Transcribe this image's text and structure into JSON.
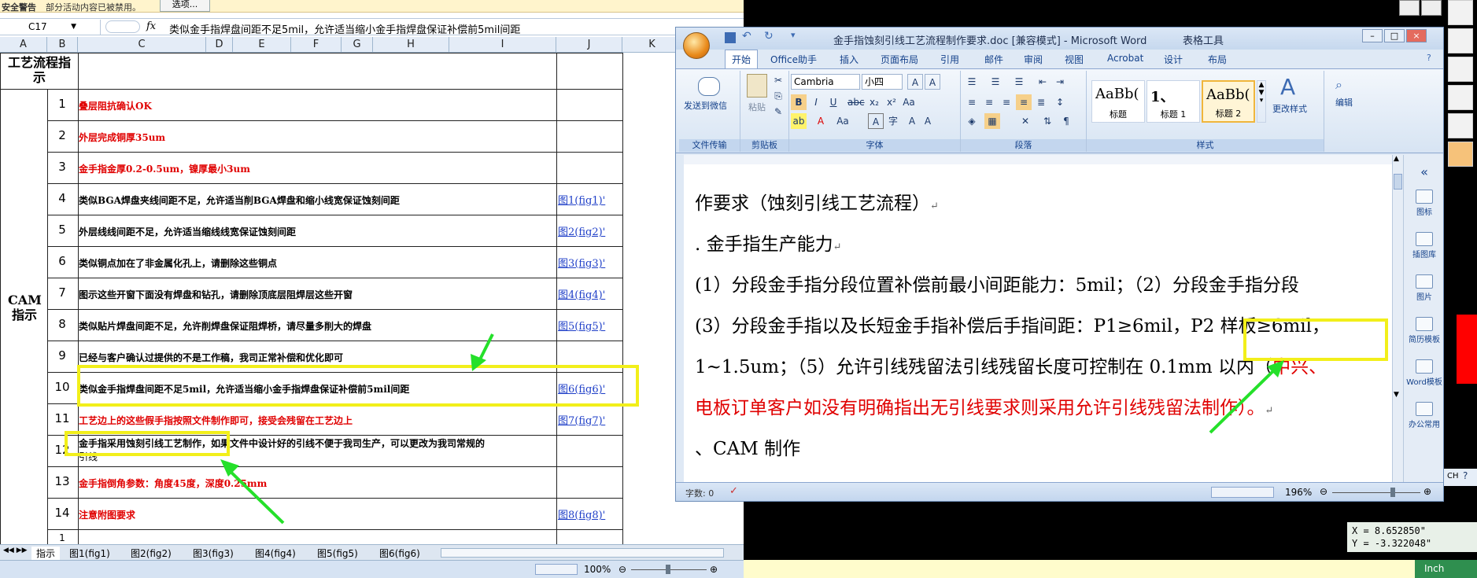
{
  "excel": {
    "security_warning": "安全警告",
    "security_msg": "部分活动内容已被禁用。",
    "options_btn": "选项...",
    "name_box": "C17",
    "fx": "fx",
    "formula": "类似金手指焊盘间距不足5mil，允许适当缩小金手指焊盘保证补偿前5mil间距",
    "columns": [
      "A",
      "B",
      "C",
      "D",
      "E",
      "F",
      "G",
      "H",
      "I",
      "J",
      "K"
    ],
    "header_cell": "工艺流程指示",
    "section": "CAM指示",
    "rows": [
      {
        "num": "1",
        "text": "叠层阻抗确认OK",
        "red": true,
        "link": ""
      },
      {
        "num": "2",
        "text": "外层完成铜厚35um",
        "red": true,
        "link": ""
      },
      {
        "num": "3",
        "text": "金手指金厚0.2-0.5um，镍厚最小3um",
        "red": true,
        "link": ""
      },
      {
        "num": "4",
        "text": "类似BGA焊盘夹线间距不足，允许适当削BGA焊盘和缩小线宽保证蚀刻间距",
        "red": false,
        "link": "图1(fig1)'"
      },
      {
        "num": "5",
        "text": "外层线线间距不足，允许适当缩线线宽保证蚀刻间距",
        "red": false,
        "link": "图2(fig2)'"
      },
      {
        "num": "6",
        "text": "类似铜点加在了非金属化孔上，请删除这些铜点",
        "red": false,
        "link": "图3(fig3)'"
      },
      {
        "num": "7",
        "text": "图示这些开窗下面没有焊盘和钻孔，请删除顶底层阻焊层这些开窗",
        "red": false,
        "link": "图4(fig4)'"
      },
      {
        "num": "8",
        "text": "类似贴片焊盘间距不足，允许削焊盘保证阻焊桥，请尽量多削大的焊盘",
        "red": false,
        "link": "图5(fig5)'"
      },
      {
        "num": "9",
        "text": "已经与客户确认过提供的不是工作稿，我司正常补偿和优化即可",
        "red": false,
        "link": ""
      },
      {
        "num": "10",
        "text": "类似金手指焊盘间距不足5mil，允许适当缩小金手指焊盘保证补偿前5mil间距",
        "red": false,
        "link": "图6(fig6)'"
      },
      {
        "num": "11",
        "text": "工艺边上的这些假手指按照文件制作即可，接受会残留在工艺边上",
        "red": true,
        "link": "图7(fig7)'"
      },
      {
        "num": "12",
        "text": "金手指采用蚀刻引线工艺制作，如果文件中设计好的引线不便于我司生产，可以更改为我司常规的",
        "text2": "引线",
        "red": false,
        "link": ""
      },
      {
        "num": "13",
        "text": "金手指倒角参数：角度45度，深度0.25mm",
        "red": true,
        "link": ""
      },
      {
        "num": "14",
        "text": "注意附图要求",
        "red": true,
        "link": "图8(fig8)'"
      }
    ],
    "row15_num": "1",
    "sheet_tabs": [
      "指示",
      "图1(fig1)",
      "图2(fig2)",
      "图3(fig3)",
      "图4(fig4)",
      "图5(fig5)",
      "图6(fig6)"
    ],
    "zoom": "100%"
  },
  "word": {
    "title": "金手指蚀刻引线工艺流程制作要求.doc [兼容模式] - Microsoft Word",
    "context_tab": "表格工具",
    "tabs": [
      "开始",
      "Office助手",
      "插入",
      "页面布局",
      "引用",
      "邮件",
      "审阅",
      "视图",
      "Acrobat",
      "设计",
      "布局"
    ],
    "groups": {
      "file_transfer": "文件传输",
      "send_wechat": "发送到微信",
      "clipboard": "剪贴板",
      "paste": "粘贴",
      "font": "字体",
      "paragraph": "段落",
      "styles": "样式",
      "change_styles": "更改样式",
      "edit": "编辑"
    },
    "font_name": "Cambria",
    "font_size": "小四",
    "style_items": [
      {
        "sample": "AaBb(",
        "name": "标题"
      },
      {
        "sample": "1、",
        "name": "标题 1"
      },
      {
        "sample": "AaBb(",
        "name": "标题 2"
      }
    ],
    "lines": {
      "l1": "作要求（蚀刻引线工艺流程）",
      "l2": ". 金手指生产能力",
      "l3": "(1）分段金手指分段位置补偿前最小间距能力：5mil；（2）分段金手指分段",
      "l4a": "(3）分段金手指以及长短金手指补偿后手指间距：P1≥6mil，",
      "l4b": "P2 样板≥6mil，",
      "l5a": "1~1.5um；（5）允许引线残留法引线残留长度可控制在 0.1mm 以内（",
      "l5b": "中兴、",
      "l6": "电板订单客户如没有明确指出无引线要求则采用允许引线残留法制作）。",
      "l7": "、CAM 制作"
    },
    "side_panel": [
      "图标",
      "插图库",
      "图片",
      "简历模板",
      "Word模板",
      "办公常用"
    ],
    "status_words": "字数: 0",
    "zoom": "196%"
  },
  "cad": {
    "x": "X = 8.652850\"",
    "y": "Y = -3.322048\"",
    "unit": "Inch",
    "lang": "CH"
  }
}
